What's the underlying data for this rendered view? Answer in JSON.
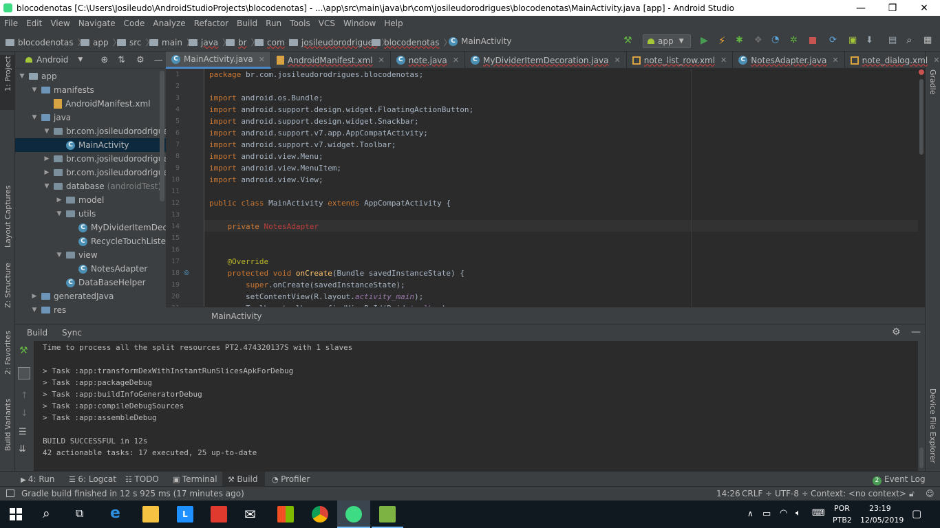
{
  "window": {
    "title": "blocodenotas [C:\\Users\\Josileudo\\AndroidStudioProjects\\blocodenotas] - ...\\app\\src\\main\\java\\br\\com\\josileudorodrigues\\blocodenotas\\MainActivity.java [app] - Android Studio"
  },
  "menu": [
    "File",
    "Edit",
    "View",
    "Navigate",
    "Code",
    "Analyze",
    "Refactor",
    "Build",
    "Run",
    "Tools",
    "VCS",
    "Window",
    "Help"
  ],
  "breadcrumb": [
    "blocodenotas",
    "app",
    "src",
    "main",
    "java",
    "br",
    "com",
    "josileudorodrigues",
    "blocodenotas",
    "MainActivity"
  ],
  "run_config": "app",
  "left_tools": [
    "1: Project",
    "Layout Captures",
    "Z: Structure",
    "2: Favorites",
    "Build Variants"
  ],
  "right_tools": [
    "Gradle",
    "Device File Explorer"
  ],
  "project": {
    "view": "Android",
    "tree": [
      {
        "label": "app",
        "depth": 0,
        "type": "module",
        "expanded": true
      },
      {
        "label": "manifests",
        "depth": 1,
        "type": "folder",
        "expanded": true
      },
      {
        "label": "AndroidManifest.xml",
        "depth": 2,
        "type": "xml"
      },
      {
        "label": "java",
        "depth": 1,
        "type": "folder",
        "expanded": true
      },
      {
        "label": "br.com.josileudorodrigues.b",
        "depth": 2,
        "type": "package",
        "expanded": true
      },
      {
        "label": "MainActivity",
        "depth": 3,
        "type": "class",
        "selected": true
      },
      {
        "label": "br.com.josileudorodrigues.b",
        "depth": 2,
        "type": "package",
        "expanded": false
      },
      {
        "label": "br.com.josileudorodrigues.b",
        "depth": 2,
        "type": "package",
        "expanded": false
      },
      {
        "label": "database",
        "depth": 2,
        "type": "package",
        "expanded": true,
        "suffix": "(androidTest)"
      },
      {
        "label": "model",
        "depth": 3,
        "type": "package",
        "expanded": false
      },
      {
        "label": "utils",
        "depth": 3,
        "type": "package",
        "expanded": true
      },
      {
        "label": "MyDividerItemDecor",
        "depth": 4,
        "type": "class"
      },
      {
        "label": "RecycleTouchListene",
        "depth": 4,
        "type": "class"
      },
      {
        "label": "view",
        "depth": 3,
        "type": "package",
        "expanded": true
      },
      {
        "label": "NotesAdapter",
        "depth": 4,
        "type": "class"
      },
      {
        "label": "DataBaseHelper",
        "depth": 3,
        "type": "class"
      },
      {
        "label": "generatedJava",
        "depth": 1,
        "type": "folder",
        "expanded": false
      },
      {
        "label": "res",
        "depth": 1,
        "type": "folder",
        "expanded": true
      }
    ]
  },
  "tabs": [
    {
      "label": "MainActivity.java",
      "active": true,
      "icon": "class"
    },
    {
      "label": "AndroidManifest.xml",
      "active": false,
      "icon": "xml"
    },
    {
      "label": "note.java",
      "active": false,
      "icon": "class"
    },
    {
      "label": "MyDividerItemDecoration.java",
      "active": false,
      "icon": "class"
    },
    {
      "label": "note_list_row.xml",
      "active": false,
      "icon": "layout"
    },
    {
      "label": "NotesAdapter.java",
      "active": false,
      "icon": "class"
    },
    {
      "label": "note_dialog.xml",
      "active": false,
      "icon": "layout"
    }
  ],
  "tabs_overflow": "≡2",
  "code_lines": [
    {
      "n": "1",
      "html": "<span class='kw'>package </span>br.com.josileudorodrigues.blocodenotas;"
    },
    {
      "n": "2",
      "html": ""
    },
    {
      "n": "3",
      "html": "<span class='kw'>import </span>android.os.Bundle;"
    },
    {
      "n": "4",
      "html": "<span class='kw'>import </span>android.support.design.widget.FloatingActionButton;"
    },
    {
      "n": "5",
      "html": "<span class='kw'>import </span>android.support.design.widget.Snackbar;"
    },
    {
      "n": "6",
      "html": "<span class='kw'>import </span>android.support.v7.app.AppCompatActivity;"
    },
    {
      "n": "7",
      "html": "<span class='kw'>import </span>android.support.v7.widget.Toolbar;"
    },
    {
      "n": "8",
      "html": "<span class='kw'>import </span>android.view.Menu;"
    },
    {
      "n": "9",
      "html": "<span class='kw'>import </span>android.view.MenuItem;"
    },
    {
      "n": "10",
      "html": "<span class='kw'>import </span>android.view.View;"
    },
    {
      "n": "11",
      "html": ""
    },
    {
      "n": "12",
      "html": "<span class='kw'>public class </span>MainActivity <span class='kw'>extends </span>AppCompatActivity {"
    },
    {
      "n": "13",
      "html": ""
    },
    {
      "n": "14",
      "html": "    <span class='kw'>private </span><span class='er'>NotesAdapter</span>"
    },
    {
      "n": "15",
      "html": ""
    },
    {
      "n": "16",
      "html": ""
    },
    {
      "n": "17",
      "html": "    <span class='an'>@Override</span>"
    },
    {
      "n": "18",
      "html": "    <span class='kw'>protected void </span><span class='fn'>onCreate</span>(Bundle savedInstanceState) {"
    },
    {
      "n": "19",
      "html": "        <span class='kw'>super</span>.onCreate(savedInstanceState);"
    },
    {
      "n": "20",
      "html": "        setContentView(R.layout.<span class='it'>activity_main</span>);"
    },
    {
      "n": "21",
      "html": "        Toolbar toolbar = findViewById(R.id.<span class='it'>toolbar</span>);"
    }
  ],
  "editor_breadcrumb": "MainActivity",
  "build": {
    "tabs": [
      "Build",
      "Sync"
    ],
    "lines": [
      "Time to process all the split resources PT2.474320137S with 1 slaves",
      "",
      "> Task :app:transformDexWithInstantRunSlicesApkForDebug",
      "> Task :app:packageDebug",
      "> Task :app:buildInfoGeneratorDebug",
      "> Task :app:compileDebugSources",
      "> Task :app:assembleDebug",
      "",
      "BUILD SUCCESSFUL in 12s",
      "42 actionable tasks: 17 executed, 25 up-to-date"
    ]
  },
  "bottom_tools": {
    "run": "4: Run",
    "logcat": "6: Logcat",
    "todo": "TODO",
    "terminal": "Terminal",
    "build": "Build",
    "profiler": "Profiler",
    "event_log": "Event Log",
    "event_count": "2"
  },
  "status": {
    "message": "Gradle build finished in 12 s 925 ms (17 minutes ago)",
    "position": "14:26",
    "line_sep": "CRLF ÷",
    "encoding": "UTF-8 ÷",
    "context": "Context: <no context>"
  },
  "taskbar": {
    "lang": "POR",
    "layout": "PTB2",
    "time": "23:19",
    "date": "12/05/2019"
  },
  "colors": {
    "accent": "#4a88c7",
    "keyword": "#cc7832",
    "run": "#499c54",
    "error": "#c75450"
  }
}
